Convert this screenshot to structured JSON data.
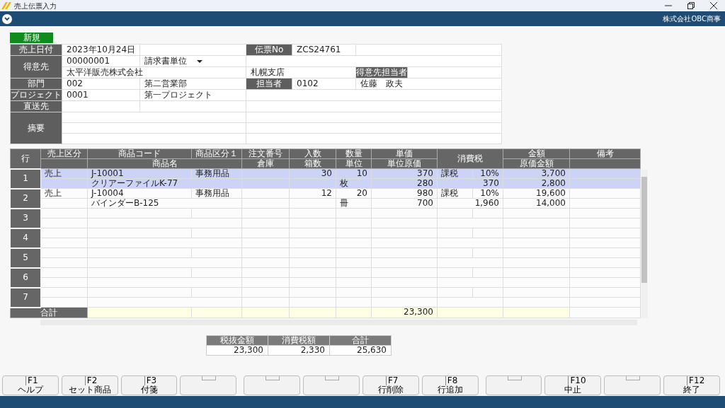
{
  "window": {
    "title": "売上伝票入力"
  },
  "header_bar": {
    "company": "株式会社OBC商事"
  },
  "form": {
    "status_badge": "新規",
    "sales_date": {
      "label": "売上日付",
      "value": "2023年10月24日"
    },
    "slip_no": {
      "label": "伝票No",
      "value": "ZCS24761"
    },
    "customer": {
      "label": "得意先",
      "code": "00000001",
      "billing_unit": "請求書単位",
      "name": "太平洋販売株式会社",
      "branch": "札幌支店",
      "contact_label": "得意先担当者"
    },
    "department": {
      "label": "部門",
      "code": "002",
      "name": "第二営業部"
    },
    "staff": {
      "label": "担当者",
      "code": "0102",
      "name": "佐藤　政夫"
    },
    "project": {
      "label": "プロジェクト",
      "code": "0001",
      "name": "第一プロジェクト"
    },
    "direct_ship": {
      "label": "直送先"
    },
    "memo": {
      "label": "摘要"
    }
  },
  "table": {
    "columns": [
      {
        "label": "行"
      },
      {
        "label": "売上区分"
      },
      {
        "label": "商品コード",
        "sub_label": "商品名"
      },
      {
        "label": "商品区分１"
      },
      {
        "label": "注文番号",
        "sub_label": "倉庫"
      },
      {
        "label": "入数",
        "sub_label": "箱数"
      },
      {
        "label": "数量",
        "sub_label": "単位"
      },
      {
        "label": "単価",
        "sub_label": "単位原価"
      },
      {
        "label": "消費税"
      },
      {
        "label": "金額",
        "sub_label": "原価金額"
      },
      {
        "label": "備考"
      }
    ],
    "rows": [
      {
        "no": "1",
        "selected": true,
        "sales_type": "売上",
        "product_code": "J-10001",
        "category": "事務用品",
        "per_case": "30",
        "quantity": "10",
        "unit_price": "370",
        "tax_type": "課税",
        "tax_rate": "10%",
        "amount": "3,700",
        "product_name": "クリアーファイルK-77",
        "unit": "枚",
        "unit_cost": "280",
        "tax_amount": "370",
        "cost_amount": "2,800"
      },
      {
        "no": "2",
        "selected": false,
        "sales_type": "売上",
        "product_code": "J-10004",
        "category": "事務用品",
        "per_case": "12",
        "quantity": "20",
        "unit_price": "980",
        "tax_type": "課税",
        "tax_rate": "10%",
        "amount": "19,600",
        "product_name": "バインダーB-125",
        "unit": "冊",
        "unit_cost": "700",
        "tax_amount": "1,960",
        "cost_amount": "14,000"
      },
      {
        "no": "3",
        "selected": false
      },
      {
        "no": "4",
        "selected": false
      },
      {
        "no": "5",
        "selected": false
      },
      {
        "no": "6",
        "selected": false
      },
      {
        "no": "7",
        "selected": false
      }
    ],
    "total": {
      "label": "合計",
      "unit_price_total": "23,300"
    }
  },
  "summary": [
    {
      "label": "税抜金額",
      "value": "23,300"
    },
    {
      "label": "消費税額",
      "value": "2,330"
    },
    {
      "label": "合計",
      "value": "25,630"
    }
  ],
  "function_keys": [
    {
      "kind": "labeled",
      "key": "F1",
      "label": "ヘルプ"
    },
    {
      "kind": "labeled",
      "key": "F2",
      "label": "セット商品"
    },
    {
      "kind": "labeled",
      "key": "F3",
      "label": "付箋"
    },
    {
      "kind": "blank"
    },
    {
      "kind": "blank"
    },
    {
      "kind": "blank"
    },
    {
      "kind": "labeled",
      "key": "F7",
      "label": "行削除"
    },
    {
      "kind": "labeled",
      "key": "F8",
      "label": "行追加"
    },
    {
      "kind": "blank"
    },
    {
      "kind": "labeled",
      "key": "F10",
      "label": "中止"
    },
    {
      "kind": "blank"
    },
    {
      "kind": "labeled",
      "key": "F12",
      "label": "終了"
    }
  ]
}
